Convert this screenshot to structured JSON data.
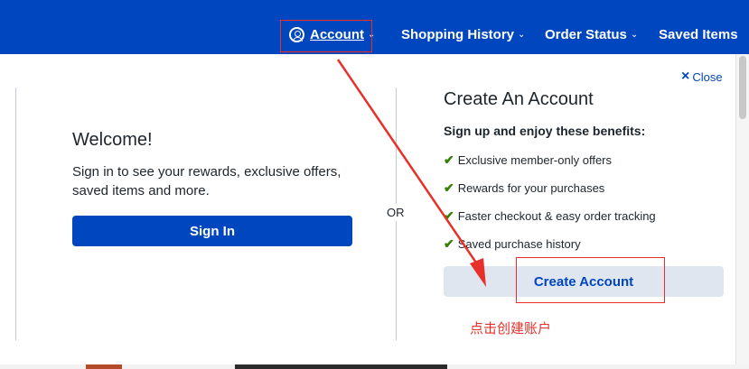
{
  "nav": {
    "account_label": "Account",
    "shopping_history_label": "Shopping History",
    "order_status_label": "Order Status",
    "saved_items_label": "Saved Items"
  },
  "welcome": {
    "title": "Welcome!",
    "description": "Sign in to see your rewards, exclusive offers, saved items and more.",
    "signin_label": "Sign In"
  },
  "divider_text": "OR",
  "close_label": "Close",
  "create": {
    "title": "Create An Account",
    "benefits_heading": "Sign up and enjoy these benefits:",
    "benefits": [
      "Exclusive member-only offers",
      "Rewards for your purchases",
      "Faster checkout & easy order tracking",
      "Saved purchase history"
    ],
    "button_label": "Create Account"
  },
  "annotation_text": "点击创建账户",
  "colors": {
    "brand_blue": "#0046be",
    "check_green": "#318000",
    "annotation_red": "#e8302a"
  }
}
